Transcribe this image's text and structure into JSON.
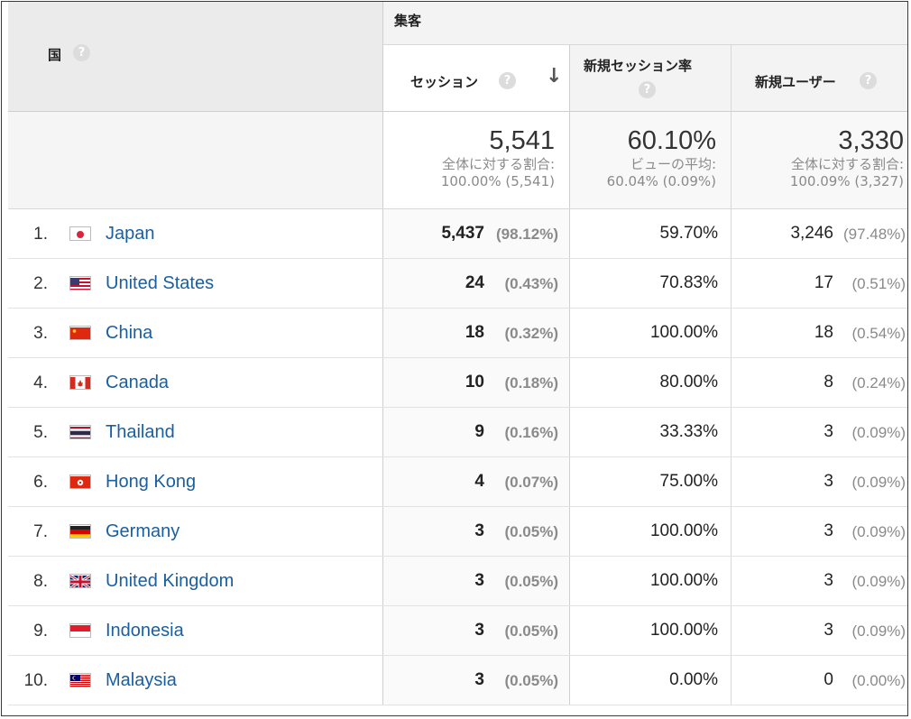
{
  "header": {
    "country_label": "国",
    "group_label": "集客",
    "columns": {
      "sessions": "セッション",
      "new_session_rate": "新規セッション率",
      "new_users": "新規ユーザー"
    },
    "help_glyph": "?",
    "sort_arrow": "↓"
  },
  "totals": {
    "sessions": {
      "value": "5,541",
      "line1": "全体に対する割合:",
      "line2": "100.00% (5,541)"
    },
    "new_session_rate": {
      "value": "60.10%",
      "line1": "ビューの平均:",
      "line2": "60.04% (0.09%)"
    },
    "new_users": {
      "value": "3,330",
      "line1": "全体に対する割合:",
      "line2": "100.09% (3,327)"
    }
  },
  "rows": [
    {
      "rank": "1.",
      "country": "Japan",
      "flag": "jp",
      "sessions": "5,437",
      "sessions_pct": "(98.12%)",
      "new_rate": "59.70%",
      "new_users": "3,246",
      "new_users_pct": "(97.48%)"
    },
    {
      "rank": "2.",
      "country": "United States",
      "flag": "us",
      "sessions": "24",
      "sessions_pct": "(0.43%)",
      "new_rate": "70.83%",
      "new_users": "17",
      "new_users_pct": "(0.51%)"
    },
    {
      "rank": "3.",
      "country": "China",
      "flag": "cn",
      "sessions": "18",
      "sessions_pct": "(0.32%)",
      "new_rate": "100.00%",
      "new_users": "18",
      "new_users_pct": "(0.54%)"
    },
    {
      "rank": "4.",
      "country": "Canada",
      "flag": "ca",
      "sessions": "10",
      "sessions_pct": "(0.18%)",
      "new_rate": "80.00%",
      "new_users": "8",
      "new_users_pct": "(0.24%)"
    },
    {
      "rank": "5.",
      "country": "Thailand",
      "flag": "th",
      "sessions": "9",
      "sessions_pct": "(0.16%)",
      "new_rate": "33.33%",
      "new_users": "3",
      "new_users_pct": "(0.09%)"
    },
    {
      "rank": "6.",
      "country": "Hong Kong",
      "flag": "hk",
      "sessions": "4",
      "sessions_pct": "(0.07%)",
      "new_rate": "75.00%",
      "new_users": "3",
      "new_users_pct": "(0.09%)"
    },
    {
      "rank": "7.",
      "country": "Germany",
      "flag": "de",
      "sessions": "3",
      "sessions_pct": "(0.05%)",
      "new_rate": "100.00%",
      "new_users": "3",
      "new_users_pct": "(0.09%)"
    },
    {
      "rank": "8.",
      "country": "United Kingdom",
      "flag": "gb",
      "sessions": "3",
      "sessions_pct": "(0.05%)",
      "new_rate": "100.00%",
      "new_users": "3",
      "new_users_pct": "(0.09%)"
    },
    {
      "rank": "9.",
      "country": "Indonesia",
      "flag": "id",
      "sessions": "3",
      "sessions_pct": "(0.05%)",
      "new_rate": "100.00%",
      "new_users": "3",
      "new_users_pct": "(0.09%)"
    },
    {
      "rank": "10.",
      "country": "Malaysia",
      "flag": "my",
      "sessions": "3",
      "sessions_pct": "(0.05%)",
      "new_rate": "0.00%",
      "new_users": "0",
      "new_users_pct": "(0.00%)"
    }
  ],
  "colors": {
    "link": "#1a5fa0",
    "header_bg": "#ebebeb",
    "muted_text": "#8a8a8a"
  }
}
